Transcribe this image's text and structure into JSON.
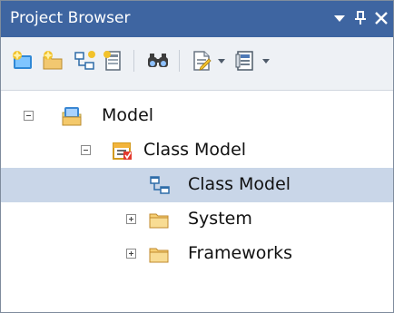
{
  "titlebar": {
    "title": "Project Browser",
    "buttons": [
      "chevron-down-icon",
      "pin-icon",
      "close-icon"
    ]
  },
  "toolbar": {
    "tools": [
      "new-model-icon",
      "new-package-icon",
      "new-diagram-icon",
      "new-element-icon",
      "find-icon",
      "document-icon",
      "more-icon"
    ]
  },
  "tree": {
    "rows": [
      {
        "label": "Model",
        "toggle": "minus",
        "icon": "model-root-icon"
      },
      {
        "label": "Class Model",
        "toggle": "minus",
        "icon": "package-icon"
      },
      {
        "label": "Class Model",
        "toggle": "none",
        "icon": "class-diagram-icon",
        "selected": true
      },
      {
        "label": "System",
        "toggle": "plus",
        "icon": "folder-icon"
      },
      {
        "label": "Frameworks",
        "toggle": "plus",
        "icon": "folder-icon"
      }
    ]
  }
}
